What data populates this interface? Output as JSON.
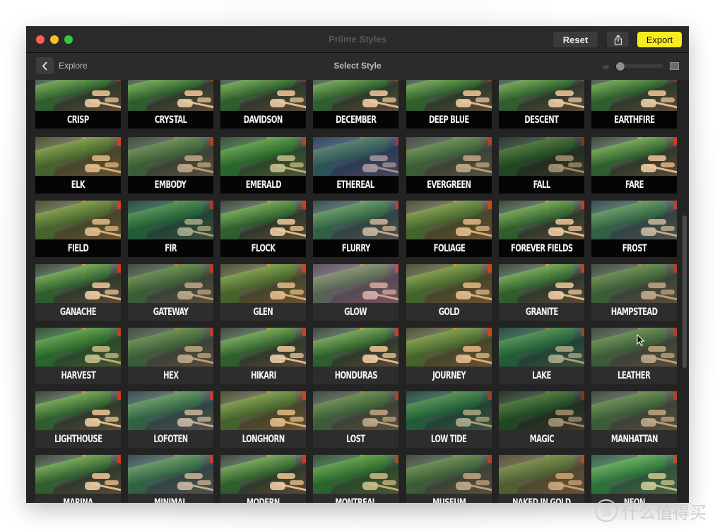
{
  "window": {
    "title": "Priime Styles",
    "reset_label": "Reset",
    "share_icon": "share-icon",
    "export_label": "Export"
  },
  "toolbar": {
    "back_icon": "chevron-left-icon",
    "back_label": "Explore",
    "section_title": "Select Style",
    "thumb_size_slider_value": 0.05
  },
  "colors": {
    "export_accent": "#f8ec1e",
    "window_bg": "#232323",
    "label_bar_dark": "#050505",
    "label_bar_gray": "#2e2d2c"
  },
  "styles": [
    {
      "name": "CRISP",
      "bar": "dark",
      "tint": "none"
    },
    {
      "name": "CRYSTAL",
      "bar": "dark",
      "tint": "none"
    },
    {
      "name": "DAVIDSON",
      "bar": "dark",
      "tint": "none"
    },
    {
      "name": "DECEMBER",
      "bar": "dark",
      "tint": "none"
    },
    {
      "name": "DEEP BLUE",
      "bar": "dark",
      "tint": "none"
    },
    {
      "name": "DESCENT",
      "bar": "dark",
      "tint": "none"
    },
    {
      "name": "EARTHFIRE",
      "bar": "dark",
      "tint": "none"
    },
    {
      "name": "ELK",
      "bar": "dark",
      "tint": "warm"
    },
    {
      "name": "EMBODY",
      "bar": "dark",
      "tint": "muted"
    },
    {
      "name": "EMERALD",
      "bar": "dark",
      "tint": "green"
    },
    {
      "name": "ETHEREAL",
      "bar": "dark",
      "tint": "blue"
    },
    {
      "name": "EVERGREEN",
      "bar": "dark",
      "tint": "muted"
    },
    {
      "name": "FALL",
      "bar": "dark",
      "tint": "dark"
    },
    {
      "name": "FARE",
      "bar": "dark",
      "tint": "none"
    },
    {
      "name": "FIELD",
      "bar": "dark",
      "tint": "warm"
    },
    {
      "name": "FIR",
      "bar": "dark",
      "tint": "teal"
    },
    {
      "name": "FLOCK",
      "bar": "dark",
      "tint": "none"
    },
    {
      "name": "FLURRY",
      "bar": "dark",
      "tint": "cool"
    },
    {
      "name": "FOLIAGE",
      "bar": "dark",
      "tint": "warm"
    },
    {
      "name": "FOREVER FIELDS",
      "bar": "dark",
      "tint": "none"
    },
    {
      "name": "FROST",
      "bar": "dark",
      "tint": "cool"
    },
    {
      "name": "GANACHE",
      "bar": "gray",
      "tint": "none"
    },
    {
      "name": "GATEWAY",
      "bar": "gray",
      "tint": "muted"
    },
    {
      "name": "GLEN",
      "bar": "gray",
      "tint": "warm"
    },
    {
      "name": "GLOW",
      "bar": "gray",
      "tint": "pink"
    },
    {
      "name": "GOLD",
      "bar": "gray",
      "tint": "warm"
    },
    {
      "name": "GRANITE",
      "bar": "gray",
      "tint": "none"
    },
    {
      "name": "HAMPSTEAD",
      "bar": "gray",
      "tint": "muted"
    },
    {
      "name": "HARVEST",
      "bar": "gray",
      "tint": "green"
    },
    {
      "name": "HEX",
      "bar": "gray",
      "tint": "muted"
    },
    {
      "name": "HIKARI",
      "bar": "gray",
      "tint": "none"
    },
    {
      "name": "HONDURAS",
      "bar": "gray",
      "tint": "none"
    },
    {
      "name": "JOURNEY",
      "bar": "gray",
      "tint": "warm"
    },
    {
      "name": "LAKE",
      "bar": "gray",
      "tint": "teal"
    },
    {
      "name": "LEATHER",
      "bar": "gray",
      "tint": "muted"
    },
    {
      "name": "LIGHTHOUSE",
      "bar": "gray",
      "tint": "none"
    },
    {
      "name": "LOFOTEN",
      "bar": "gray",
      "tint": "cool"
    },
    {
      "name": "LONGHORN",
      "bar": "gray",
      "tint": "warm"
    },
    {
      "name": "LOST",
      "bar": "gray",
      "tint": "muted"
    },
    {
      "name": "LOW TIDE",
      "bar": "gray",
      "tint": "teal"
    },
    {
      "name": "MAGIC",
      "bar": "gray",
      "tint": "dark"
    },
    {
      "name": "MANHATTAN",
      "bar": "gray",
      "tint": "muted"
    },
    {
      "name": "MARINA",
      "bar": "gray",
      "tint": "none"
    },
    {
      "name": "MINIMAL",
      "bar": "gray",
      "tint": "cool"
    },
    {
      "name": "MODERN",
      "bar": "gray",
      "tint": "none"
    },
    {
      "name": "MONTREAL",
      "bar": "gray",
      "tint": "green"
    },
    {
      "name": "MUSEUM",
      "bar": "gray",
      "tint": "muted"
    },
    {
      "name": "NAKED IN GOLD",
      "bar": "gray",
      "tint": "sepia"
    },
    {
      "name": "NEON",
      "bar": "gray",
      "tint": "vivid"
    }
  ],
  "watermark": {
    "icon_char": "值",
    "text": "什么值得买"
  }
}
